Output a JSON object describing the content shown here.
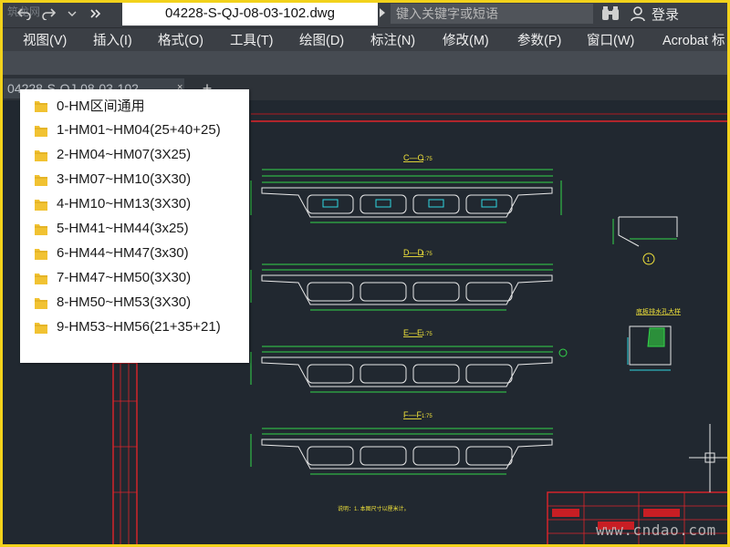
{
  "titlebar": {
    "document_name": "04228-S-QJ-08-03-102.dwg",
    "search_placeholder": "键入关键字或短语",
    "login_label": "登录",
    "watermark_topleft": "筑龙网"
  },
  "menu": {
    "items": [
      "视图(V)",
      "插入(I)",
      "格式(O)",
      "工具(T)",
      "绘图(D)",
      "标注(N)",
      "修改(M)",
      "参数(P)",
      "窗口(W)",
      "Acrobat 标"
    ]
  },
  "tabs": {
    "active_tab": "04228-S-QJ-08-03-102",
    "close_glyph": "×",
    "new_tab_glyph": "+"
  },
  "folder_list": {
    "items": [
      "0-HM区间通用",
      "1-HM01~HM04(25+40+25)",
      "2-HM04~HM07(3X25)",
      "3-HM07~HM10(3X30)",
      "4-HM10~HM13(3X30)",
      "5-HM41~HM44(3x25)",
      "6-HM44~HM47(3x30)",
      "7-HM47~HM50(3X30)",
      "8-HM50~HM53(3X30)",
      "9-HM53~HM56(21+35+21)"
    ]
  },
  "drawing": {
    "section_titles": [
      "C—C",
      "D—D",
      "E—E",
      "F—F"
    ],
    "section_scale": "1:75",
    "detail_title": "底板排水孔大样",
    "detail_marker": "1",
    "note": "说明：1. 本图尺寸以厘米计。",
    "background_color": "#212830",
    "line_color_green": "#33d64a",
    "line_color_white": "#e8e8e8",
    "line_color_red": "#e0242a",
    "line_color_yellow": "#f0e23a",
    "line_color_cyan": "#2fd6e0"
  },
  "watermark": {
    "text": "www.cndao.com"
  },
  "colors": {
    "frame_border": "#f2d21b",
    "chrome_bg": "#3b3f45",
    "folder_icon": "#f1c232"
  }
}
